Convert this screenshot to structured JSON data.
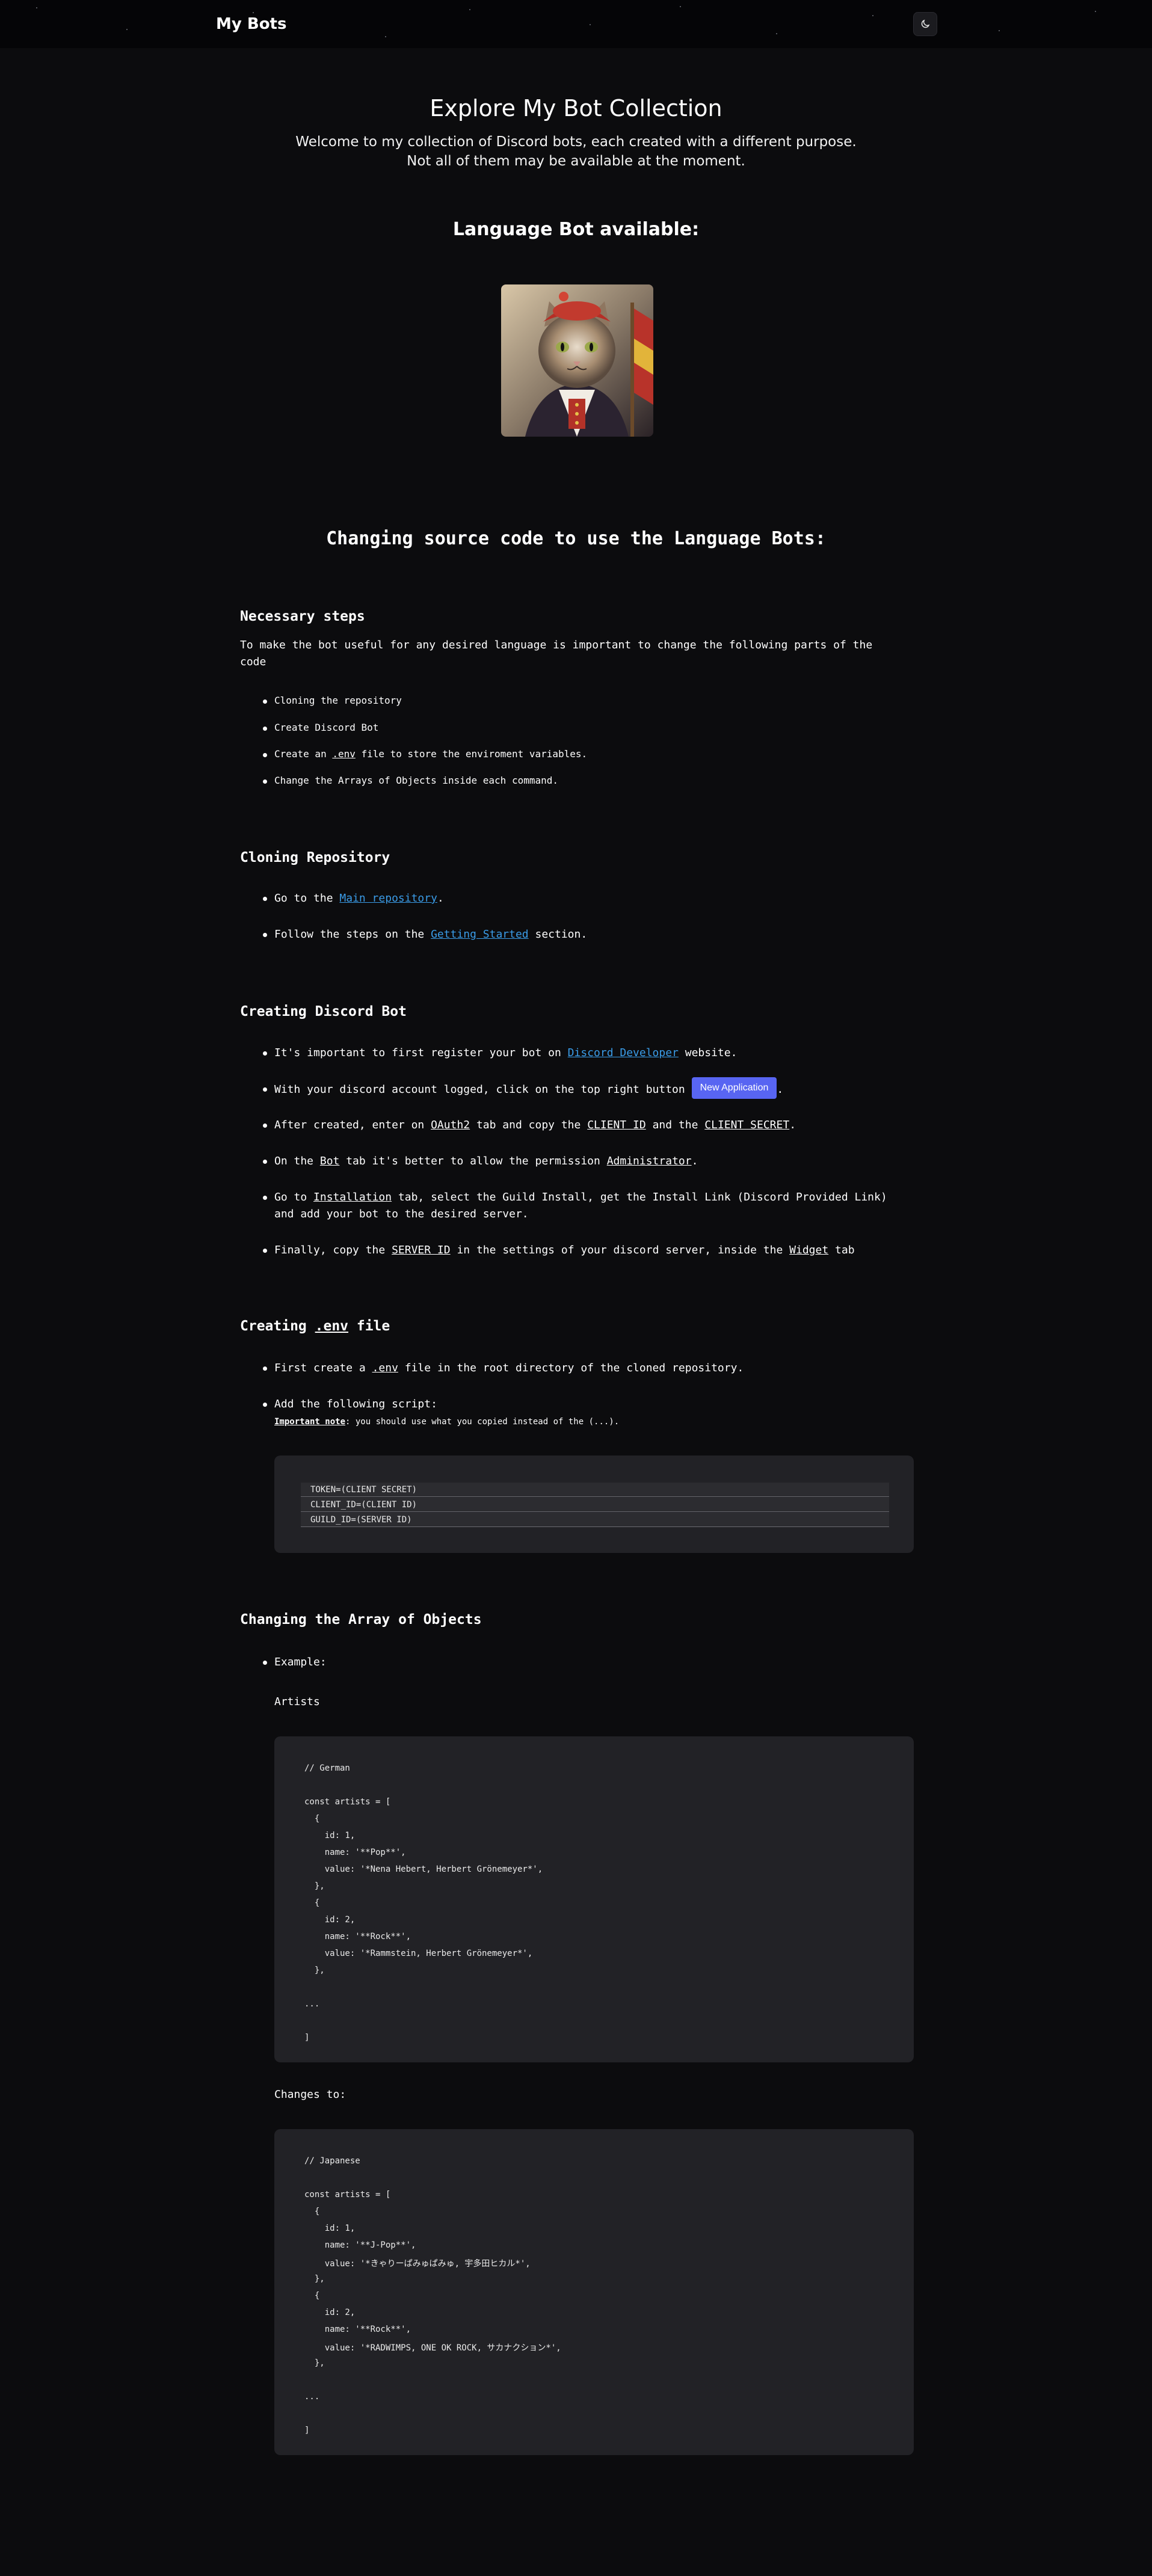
{
  "navbar": {
    "brand": "My Bots",
    "theme_icon": "moon-icon"
  },
  "hero": {
    "title": "Explore My Bot Collection",
    "line1": "Welcome to my collection of Discord bots, each created with a different purpose.",
    "line2": "Not all of them may be available at the moment."
  },
  "available": {
    "title": "Language Bot available:",
    "image_name": "cat-bot-avatar"
  },
  "source": {
    "title": "Changing source code to use the Language Bots:"
  },
  "necessary": {
    "title": "Necessary steps",
    "intro": "To make the bot useful for any desired language is important to change the following parts of the code",
    "items": {
      "i1": "Cloning the repository",
      "i2": "Create Discord Bot",
      "i3_a": "Create an ",
      "i3_b": ".env",
      "i3_c": " file to store the enviroment variables.",
      "i4": "Change the Arrays of Objects inside each command."
    }
  },
  "cloning": {
    "title": "Cloning Repository",
    "i1_a": "Go to the ",
    "i1_link": "Main repository",
    "i1_c": ".",
    "i2_a": "Follow the steps on the ",
    "i2_link": "Getting Started",
    "i2_c": " section."
  },
  "creating": {
    "title": "Creating Discord Bot",
    "i1_a": "It's important to first register your bot on ",
    "i1_link": "Discord Developer",
    "i1_c": " website.",
    "i2_a": "With your discord account logged, click on the top right button ",
    "i2_button": "New Application",
    "i2_c": ".",
    "i3_a": "After created, enter on ",
    "i3_b": "OAuth2",
    "i3_c": " tab and copy the ",
    "i3_d": "CLIENT ID",
    "i3_e": " and the ",
    "i3_f": "CLIENT SECRET",
    "i3_g": ".",
    "i4_a": "On the ",
    "i4_b": "Bot",
    "i4_c": " tab it's better to allow the permission ",
    "i4_d": "Administrator",
    "i4_e": ".",
    "i5_a": "Go to ",
    "i5_b": "Installation",
    "i5_c": " tab, select the Guild Install, get the Install Link (Discord Provided Link)",
    "i5_d": "and add your bot to the desired server.",
    "i6_a": "Finally, copy the ",
    "i6_b": "SERVER ID",
    "i6_c": " in the settings of your discord server, inside the ",
    "i6_d": "Widget",
    "i6_e": " tab"
  },
  "envfile": {
    "title_a": "Creating ",
    "title_b": ".env",
    "title_c": " file",
    "i1_a": "First create a ",
    "i1_b": ".env",
    "i1_c": " file in the root directory of the cloned repository.",
    "i2": "Add the following script:",
    "note_label": "Important note",
    "note_text": ": you should use what you copied instead of the (...).",
    "lines": [
      "TOKEN=(CLIENT SECRET)",
      "CLIENT_ID=(CLIENT ID)",
      "GUILD_ID=(SERVER ID)"
    ]
  },
  "arrays": {
    "title": "Changing the Array of Objects",
    "example": "Example:",
    "artists_label": "Artists",
    "changes_label": "Changes to:",
    "code1": [
      "// German",
      "",
      "const artists = [",
      "  {",
      "    id: 1,",
      "    name: '**Pop**',",
      "    value: '*Nena Hebert, Herbert Grönemeyer*',",
      "  },",
      "  {",
      "    id: 2,",
      "    name: '**Rock**',",
      "    value: '*Rammstein, Herbert Grönemeyer*',",
      "  },",
      "",
      "...",
      "",
      "]"
    ],
    "code2": [
      "// Japanese",
      "",
      "const artists = [",
      "  {",
      "    id: 1,",
      "    name: '**J-Pop**',",
      "    value: '*きゃりーぱみゅぱみゅ, 宇多田ヒカル*',",
      "  },",
      "  {",
      "    id: 2,",
      "    name: '**Rock**',",
      "    value: '*RADWIMPS, ONE OK ROCK, サカナクション*',",
      "  },",
      "",
      "...",
      "",
      "]"
    ]
  }
}
